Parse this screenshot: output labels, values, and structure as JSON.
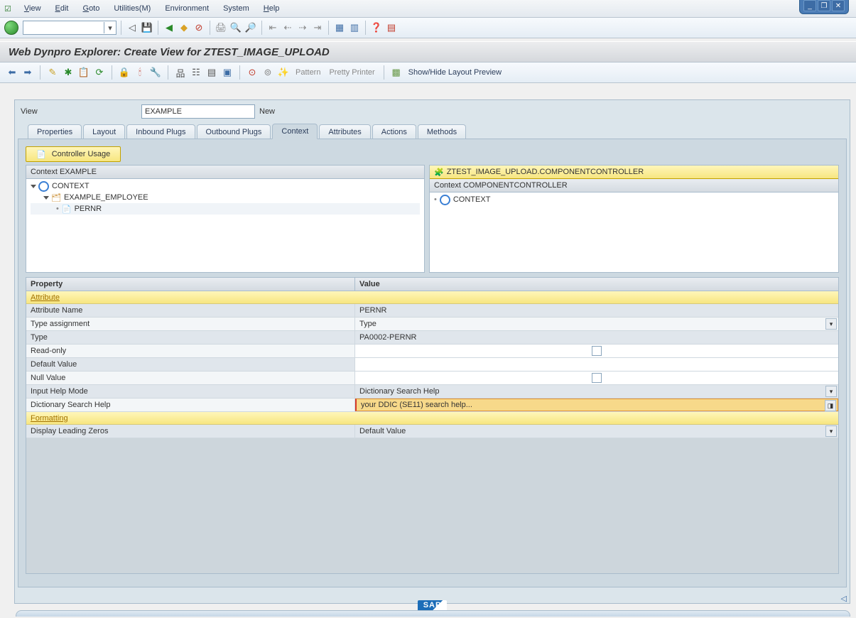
{
  "menubar": {
    "items": [
      "View",
      "Edit",
      "Goto",
      "Utilities(M)",
      "Environment",
      "System",
      "Help"
    ]
  },
  "window_controls": {
    "minimize": "_",
    "maximize": "❐",
    "close": "✕"
  },
  "toolbar1": {
    "icons": [
      {
        "name": "back-icon",
        "glyph": "◁",
        "color": "#555"
      },
      {
        "name": "save-icon",
        "glyph": "💾",
        "color": "#c9a227"
      },
      {
        "name": "back2-icon",
        "glyph": "◉",
        "color": "#2a8a2a"
      },
      {
        "name": "exit-icon",
        "glyph": "◉",
        "color": "#d9a227"
      },
      {
        "name": "cancel-icon",
        "glyph": "◉",
        "color": "#c03a2a"
      },
      {
        "name": "print-icon",
        "glyph": "🖨",
        "color": "#888"
      },
      {
        "name": "find-icon",
        "glyph": "🔍",
        "color": "#888"
      },
      {
        "name": "findnext-icon",
        "glyph": "🔎",
        "color": "#888"
      },
      {
        "name": "first-icon",
        "glyph": "⇤",
        "color": "#888"
      },
      {
        "name": "prev-icon",
        "glyph": "⇠",
        "color": "#888"
      },
      {
        "name": "next-icon",
        "glyph": "⇢",
        "color": "#888"
      },
      {
        "name": "last-icon",
        "glyph": "⇥",
        "color": "#888"
      },
      {
        "name": "new-session-icon",
        "glyph": "▦",
        "color": "#3d6ca5"
      },
      {
        "name": "layout-icon",
        "glyph": "▥",
        "color": "#3d6ca5"
      },
      {
        "name": "help-icon",
        "glyph": "❓",
        "color": "#d9a227"
      },
      {
        "name": "customize-icon",
        "glyph": "▤",
        "color": "#c03a2a"
      }
    ]
  },
  "title": "Web Dynpro Explorer: Create View for ZTEST_IMAGE_UPLOAD",
  "toolbar2": {
    "pattern": "Pattern",
    "pretty": "Pretty Printer",
    "showhide": "Show/Hide Layout Preview"
  },
  "viewrow": {
    "label": "View",
    "value": "EXAMPLE",
    "status": "New"
  },
  "tabs": [
    "Properties",
    "Layout",
    "Inbound Plugs",
    "Outbound Plugs",
    "Context",
    "Attributes",
    "Actions",
    "Methods"
  ],
  "active_tab": "Context",
  "controller_usage": "Controller Usage",
  "left_panel": {
    "title": "Context EXAMPLE",
    "tree": [
      {
        "level": 0,
        "icon": "context",
        "label": "CONTEXT",
        "expand": true
      },
      {
        "level": 1,
        "icon": "node",
        "label": "EXAMPLE_EMPLOYEE",
        "expand": true
      },
      {
        "level": 2,
        "icon": "leaf",
        "label": "PERNR",
        "selected": true
      }
    ]
  },
  "right_panel": {
    "title_icon": "component-icon",
    "title": "ZTEST_IMAGE_UPLOAD.COMPONENTCONTROLLER",
    "subtitle": "Context COMPONENTCONTROLLER",
    "tree": [
      {
        "level": 0,
        "icon": "context",
        "label": "CONTEXT"
      }
    ]
  },
  "properties": {
    "headers": {
      "c1": "Property",
      "c2": "Value"
    },
    "section1": "Attribute",
    "rows": [
      {
        "p": "Attribute Name",
        "v": "PERNR"
      },
      {
        "p": "Type assignment",
        "v": "Type",
        "dd": true
      },
      {
        "p": "Type",
        "v": "PA0002-PERNR"
      },
      {
        "p": "Read-only",
        "v": "",
        "chk": true,
        "white": true
      },
      {
        "p": "Default Value",
        "v": "",
        "white": true
      },
      {
        "p": "Null Value",
        "v": "",
        "chk": true,
        "white": true
      },
      {
        "p": "Input Help Mode",
        "v": "Dictionary Search Help",
        "dd": true
      },
      {
        "p": "Dictionary Search Help",
        "v": "your DDIC (SE11) search help...",
        "highlight": true,
        "f4": true
      }
    ],
    "section2": "Formatting",
    "rows2": [
      {
        "p": "Display Leading Zeros",
        "v": "Default Value",
        "dd": true
      }
    ]
  },
  "sap": "SAP"
}
